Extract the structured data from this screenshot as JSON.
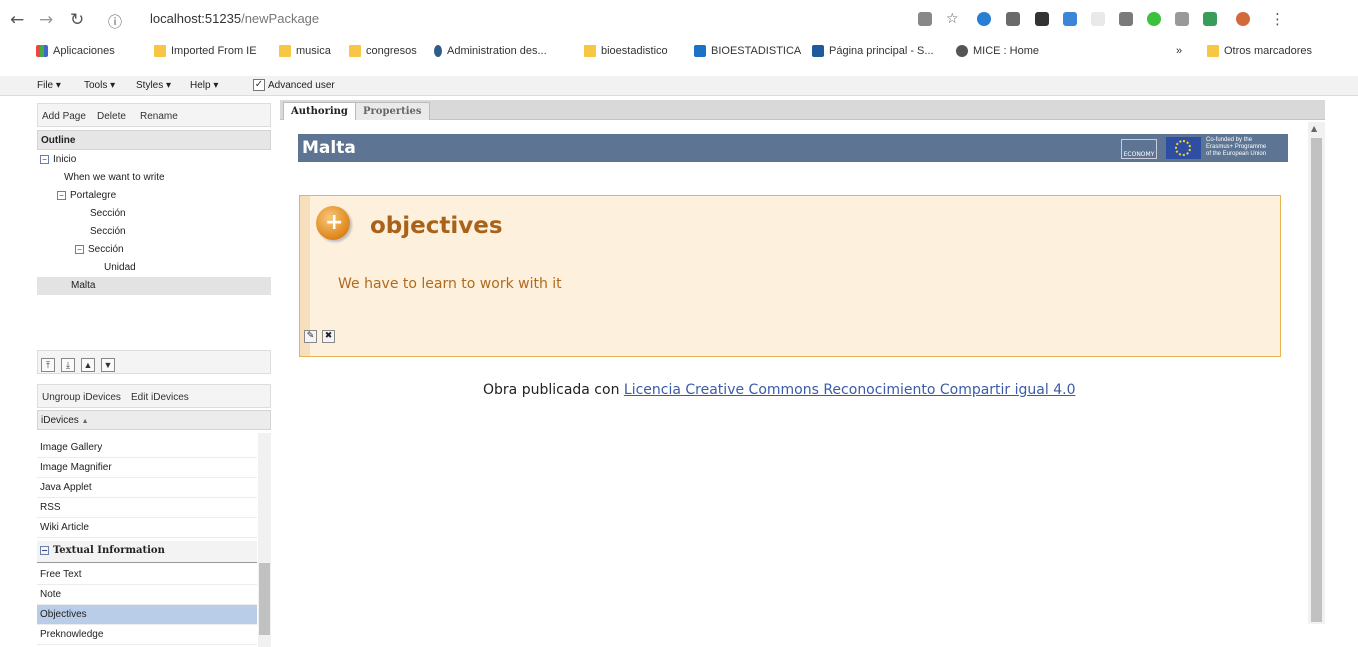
{
  "browser": {
    "url_host": "localhost:51235",
    "url_path": "/newPackage",
    "bookmarks": [
      {
        "label": "Aplicaciones",
        "icon": "apps-grid-icon"
      },
      {
        "label": "Imported From IE",
        "icon": "folder-icon"
      },
      {
        "label": "musica",
        "icon": "folder-icon"
      },
      {
        "label": "congresos",
        "icon": "folder-icon"
      },
      {
        "label": "Administration des...",
        "icon": "site-icon"
      },
      {
        "label": "bioestadistico",
        "icon": "folder-icon"
      },
      {
        "label": "BIOESTADISTICA",
        "icon": "site-icon"
      },
      {
        "label": "Página principal - S...",
        "icon": "site-icon"
      },
      {
        "label": "MICE : Home",
        "icon": "globe-icon"
      }
    ],
    "more": "»",
    "other_bookmarks": "Otros marcadores"
  },
  "menubar": {
    "file": "File",
    "tools": "Tools",
    "styles": "Styles",
    "help": "Help",
    "advanced_user": "Advanced user"
  },
  "outline_toolbar": {
    "add_page": "Add Page",
    "delete": "Delete",
    "rename": "Rename"
  },
  "outline": {
    "title": "Outline",
    "items": [
      {
        "label": "Inicio",
        "depth": 0,
        "expandable": true
      },
      {
        "label": "When we want to write",
        "depth": 1
      },
      {
        "label": "Portalegre",
        "depth": 1,
        "expandable": true
      },
      {
        "label": "Sección",
        "depth": 2
      },
      {
        "label": "Sección",
        "depth": 2
      },
      {
        "label": "Sección",
        "depth": 2,
        "expandable": true
      },
      {
        "label": "Unidad",
        "depth": 3
      },
      {
        "label": "Malta",
        "depth": 1,
        "selected": true
      }
    ]
  },
  "idevices_toolbar": {
    "ungroup": "Ungroup iDevices",
    "edit": "Edit iDevices"
  },
  "idevices": {
    "header": "iDevices",
    "sort_indicator": "▲",
    "group1_items": [
      "Image Gallery",
      "Image Magnifier",
      "Java Applet",
      "RSS",
      "Wiki Article"
    ],
    "group2_title": "Textual Information",
    "group2_items": [
      "Free Text",
      "Note",
      "Objectives",
      "Preknowledge"
    ],
    "selected": "Objectives"
  },
  "tabs": {
    "authoring": "Authoring",
    "properties": "Properties"
  },
  "page": {
    "title": "Malta",
    "economy_logo": "ECONOMY",
    "eu_text": [
      "Co-funded by the",
      "Erasmus+ Programme",
      "of the European Union"
    ],
    "idevice_title": "objectives",
    "idevice_text": "We have to learn to work with it",
    "license_prefix": "Obra publicada con ",
    "license_link": "Licencia Creative Commons Reconocimiento Compartir igual 4.0"
  }
}
